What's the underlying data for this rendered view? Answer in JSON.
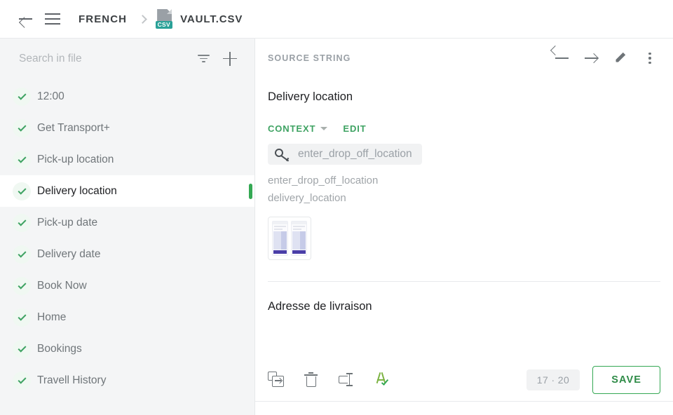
{
  "topbar": {
    "back_icon": "arrow-left-icon",
    "menu_icon": "hamburger-menu-icon",
    "breadcrumb_language": "FRENCH",
    "separator_icon": "chevron-right-icon",
    "file_icon": "csv-file-icon",
    "file_badge": "CSV",
    "file_name": "VAULT.CSV"
  },
  "sidebar": {
    "search": {
      "placeholder": "Search in file",
      "value": "",
      "filter_icon": "filter-icon",
      "add_icon": "plus-icon"
    },
    "items": [
      {
        "label": "12:00",
        "status_icon": "check-icon",
        "selected": false
      },
      {
        "label": "Get Transport+",
        "status_icon": "check-icon",
        "selected": false
      },
      {
        "label": "Pick-up location",
        "status_icon": "check-icon",
        "selected": false
      },
      {
        "label": "Delivery location",
        "status_icon": "check-icon",
        "selected": true
      },
      {
        "label": "Pick-up date",
        "status_icon": "check-icon",
        "selected": false
      },
      {
        "label": "Delivery date",
        "status_icon": "check-icon",
        "selected": false
      },
      {
        "label": "Book Now",
        "status_icon": "check-icon",
        "selected": false
      },
      {
        "label": "Home",
        "status_icon": "check-icon",
        "selected": false
      },
      {
        "label": "Bookings",
        "status_icon": "check-icon",
        "selected": false
      },
      {
        "label": "Travell History",
        "status_icon": "check-icon",
        "selected": false
      }
    ]
  },
  "detail": {
    "panel_label": "SOURCE STRING",
    "prev_icon": "arrow-left-icon",
    "next_icon": "arrow-right-icon",
    "edit_icon": "pencil-icon",
    "more_icon": "more-vertical-icon",
    "source_string": "Delivery location",
    "context_label": "CONTEXT",
    "context_caret_icon": "chevron-down-icon",
    "edit_label": "EDIT",
    "key_icon": "key-icon",
    "key_name": "enter_drop_off_location",
    "context_lines": [
      "enter_drop_off_location",
      "delivery_location"
    ],
    "screenshot_thumb": "app-screenshot-thumbnail",
    "translation": "Adresse de livraison"
  },
  "footer": {
    "icons": [
      {
        "name": "copy-to-icon",
        "label": "Copy source to translation"
      },
      {
        "name": "trash-icon",
        "label": "Delete translation"
      },
      {
        "name": "split-string-icon",
        "label": "Split string"
      },
      {
        "name": "spellcheck-icon",
        "label": "Spellcheck"
      }
    ],
    "counter": "17 · 20",
    "save_label": "SAVE"
  },
  "colors": {
    "accent_green": "#34a853",
    "text_primary": "#202124",
    "text_muted": "#9aa0a6",
    "sidebar_bg": "#f4f5f6",
    "csv_badge": "#2aa198"
  }
}
